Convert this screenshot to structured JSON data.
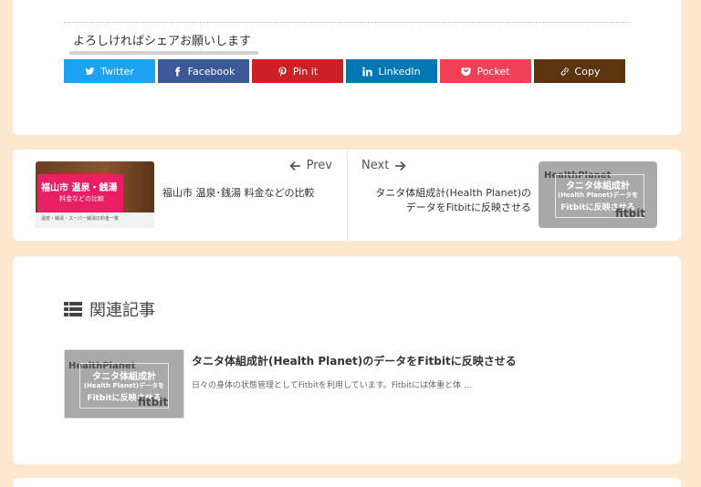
{
  "share": {
    "heading": "よろしければシェアお願いします",
    "buttons": [
      {
        "label": "Twitter",
        "icon": "twitter-icon",
        "color": "#1da1f2"
      },
      {
        "label": "Facebook",
        "icon": "facebook-icon",
        "color": "#3b5998"
      },
      {
        "label": "Pin it",
        "icon": "pinterest-icon",
        "color": "#cb2027"
      },
      {
        "label": "LinkedIn",
        "icon": "linkedin-icon",
        "color": "#0077b5"
      },
      {
        "label": "Pocket",
        "icon": "pocket-icon",
        "color": "#ef4056"
      },
      {
        "label": "Copy",
        "icon": "link-icon",
        "color": "#5b3410"
      }
    ]
  },
  "nav": {
    "prev": {
      "label": "Prev",
      "title": "福山市 温泉･銭湯 料金などの比較",
      "thumb": {
        "line1": "福山市 温泉・銭湯",
        "line2": "料金などの比較",
        "footer": "温泉・銭湯・スーパー銭湯の料金一覧"
      }
    },
    "next": {
      "label": "Next",
      "title_line1": "タニタ体組成計(Health Planet)の",
      "title_line2": "データをFitbitに反映させる",
      "thumb": {
        "brand": "HealthPlanet",
        "line1": "タニタ体組成計",
        "line2": "(Health Planet)データを",
        "line3": "Fitbitに反映させる",
        "logo": "fitbit"
      }
    }
  },
  "related": {
    "heading": "関連記事",
    "items": [
      {
        "title": "タニタ体組成計(Health Planet)のデータをFitbitに反映させる",
        "excerpt": "日々の身体の状態管理としてFitbitを利用しています。Fitbitには体重と体 ...",
        "thumb": {
          "brand": "HealthPlanet",
          "line1": "タニタ体組成計",
          "line2": "(Health Planet)データを",
          "line3": "Fitbitに反映させる",
          "logo": "fitbit"
        }
      }
    ]
  },
  "colors": {
    "background": "#fde8cf",
    "card": "#ffffff"
  }
}
